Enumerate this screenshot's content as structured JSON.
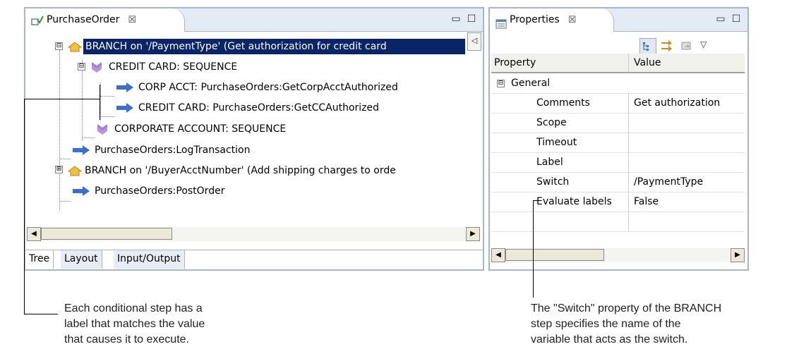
{
  "left_panel": {
    "tab_title": "PurchaseOrder",
    "tab_close": "☒",
    "minimize_glyph": "▭",
    "maximize_glyph": "☐",
    "tree": [
      {
        "text": "BRANCH on '/PaymentType' (Get authorization for credit card",
        "icon": "branch-icon",
        "expander": "⊟",
        "selected": true
      },
      {
        "text": "CREDIT CARD: SEQUENCE",
        "icon": "sequence-icon",
        "expander": "⊟"
      },
      {
        "text": "CORP ACCT: PurchaseOrders:GetCorpAcctAuthorized",
        "icon": "call-arrow-icon"
      },
      {
        "text": "CREDIT CARD: PurchaseOrders:GetCCAuthorized",
        "icon": "call-arrow-icon"
      },
      {
        "text": "CORPORATE ACCOUNT: SEQUENCE",
        "icon": "sequence-icon"
      },
      {
        "text": "PurchaseOrders:LogTransaction",
        "icon": "call-arrow-icon"
      },
      {
        "text": "BRANCH on '/BuyerAcctNumber' (Add shipping charges to orde",
        "icon": "branch-icon",
        "expander": "⊞"
      },
      {
        "text": "PurchaseOrders:PostOrder",
        "icon": "call-arrow-icon"
      }
    ],
    "bottom_tabs": [
      "Tree",
      "Layout",
      "Input/Output"
    ]
  },
  "right_panel": {
    "tab_title": "Properties",
    "tab_close": "☒",
    "columns": [
      "Property",
      "Value"
    ],
    "group": {
      "expander": "⊟",
      "label": "General"
    },
    "rows": [
      {
        "property": "Comments",
        "value": "Get authorization"
      },
      {
        "property": "Scope",
        "value": ""
      },
      {
        "property": "Timeout",
        "value": ""
      },
      {
        "property": "Label",
        "value": ""
      },
      {
        "property": "Switch",
        "value": "/PaymentType"
      },
      {
        "property": "Evaluate labels",
        "value": "False"
      }
    ]
  },
  "captions": {
    "left": [
      "Each conditional step has a",
      "label that matches the value",
      "that causes it to execute."
    ],
    "right": [
      "The \"Switch\" property of the BRANCH",
      "step specifies the name of the",
      "variable that acts as the switch."
    ]
  },
  "colors": {
    "selection": "#0a246a",
    "panel_border": "#a8b4c8",
    "arrow": "#3a6fd0",
    "sequence": "#9b6fcf",
    "branch": "#e0a020"
  }
}
